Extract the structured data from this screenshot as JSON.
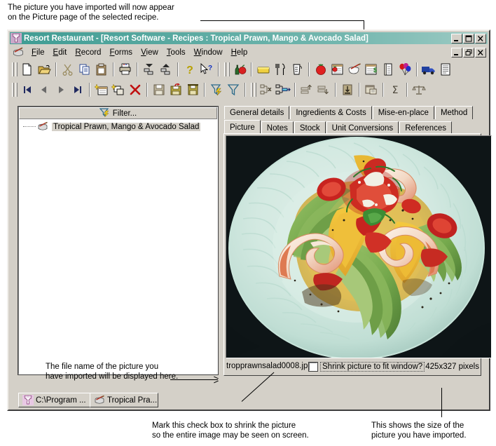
{
  "annotations": {
    "top": "The picture you have imported will now appear\non the Picture page of the selected recipe.",
    "filename_note": "The file name of the picture you\nhave imported will be displayed here.",
    "checkbox_note": "Mark this check box to shrink the picture\nso the entire image may be seen on screen.",
    "size_note": "This shows the size of the\npicture you have imported."
  },
  "window": {
    "title": "Resort Restaurant - [Resort Software - Recipes : Tropical Prawn, Mango & Avocado Salad]",
    "icon": "restaurant-app-icon",
    "titlebar_color": "#3f9c93",
    "face_color": "#d4d0c8",
    "controls": [
      {
        "name": "minimize",
        "glyph": "_"
      },
      {
        "name": "maximize",
        "glyph": "□"
      },
      {
        "name": "close",
        "glyph": "×"
      }
    ],
    "mdi_controls": [
      {
        "name": "mdi-minimize",
        "glyph": "_"
      },
      {
        "name": "mdi-restore",
        "glyph": "❐"
      },
      {
        "name": "mdi-close",
        "glyph": "×"
      }
    ]
  },
  "menu": {
    "mdi_icon": "recipe-pot-icon",
    "items": [
      {
        "label": "File",
        "accel": "F"
      },
      {
        "label": "Edit",
        "accel": "E"
      },
      {
        "label": "Record",
        "accel": "R"
      },
      {
        "label": "Forms",
        "accel": "F"
      },
      {
        "label": "View",
        "accel": "V"
      },
      {
        "label": "Tools",
        "accel": "T"
      },
      {
        "label": "Window",
        "accel": "W"
      },
      {
        "label": "Help",
        "accel": "H"
      }
    ]
  },
  "toolbar1": [
    {
      "name": "new-document-icon",
      "type": "btn"
    },
    {
      "name": "open-folder-icon",
      "type": "btn"
    },
    {
      "name": "separator",
      "type": "sep"
    },
    {
      "name": "cut-scissors-icon",
      "type": "btn"
    },
    {
      "name": "copy-icon",
      "type": "btn"
    },
    {
      "name": "paste-clipboard-icon",
      "type": "btn"
    },
    {
      "name": "separator",
      "type": "sep"
    },
    {
      "name": "print-icon",
      "type": "btn"
    },
    {
      "name": "separator",
      "type": "sep"
    },
    {
      "name": "collapse-all-icon",
      "type": "btn"
    },
    {
      "name": "expand-all-icon",
      "type": "btn"
    },
    {
      "name": "separator",
      "type": "sep"
    },
    {
      "name": "help-question-icon",
      "type": "btn"
    },
    {
      "name": "context-help-icon",
      "type": "btn"
    },
    {
      "name": "separator-double",
      "type": "sep2"
    },
    {
      "name": "bottle-and-apple-icon",
      "type": "btn"
    },
    {
      "name": "separator",
      "type": "sep"
    },
    {
      "name": "yellow-tray-icon",
      "type": "btn"
    },
    {
      "name": "cutlery-icon",
      "type": "btn"
    },
    {
      "name": "measuring-jug-icon",
      "type": "btn"
    },
    {
      "name": "separator",
      "type": "sep"
    },
    {
      "name": "tomato-icon",
      "type": "btn"
    },
    {
      "name": "ingredients-list-icon",
      "type": "btn"
    },
    {
      "name": "mixing-bowl-icon",
      "type": "btn"
    },
    {
      "name": "costing-sheet-icon",
      "type": "btn"
    },
    {
      "name": "menu-card-icon",
      "type": "btn"
    },
    {
      "name": "balloons-icon",
      "type": "btn"
    },
    {
      "name": "separator",
      "type": "sep"
    },
    {
      "name": "delivery-truck-icon",
      "type": "btn"
    },
    {
      "name": "report-icon",
      "type": "btn"
    }
  ],
  "toolbar2": [
    {
      "name": "first-record-icon",
      "type": "btn"
    },
    {
      "name": "previous-record-icon",
      "type": "btn"
    },
    {
      "name": "next-record-icon",
      "type": "btn"
    },
    {
      "name": "last-record-icon",
      "type": "btn"
    },
    {
      "name": "separator",
      "type": "sep"
    },
    {
      "name": "new-record-icon",
      "type": "btn"
    },
    {
      "name": "duplicate-record-icon",
      "type": "btn"
    },
    {
      "name": "delete-record-icon",
      "type": "btn"
    },
    {
      "name": "separator",
      "type": "sep"
    },
    {
      "name": "save-icon",
      "type": "btn"
    },
    {
      "name": "save-and-return-icon",
      "type": "btn"
    },
    {
      "name": "save-and-close-icon",
      "type": "btn"
    },
    {
      "name": "separator",
      "type": "sep"
    },
    {
      "name": "quick-filter-icon",
      "type": "btn"
    },
    {
      "name": "filter-icon",
      "type": "btn"
    },
    {
      "name": "separator-double",
      "type": "sep2"
    },
    {
      "name": "remove-link-icon",
      "type": "btn"
    },
    {
      "name": "add-link-icon",
      "type": "btn"
    },
    {
      "name": "separator",
      "type": "sep"
    },
    {
      "name": "move-up-icon",
      "type": "btn"
    },
    {
      "name": "move-down-icon",
      "type": "btn"
    },
    {
      "name": "separator",
      "type": "sep"
    },
    {
      "name": "import-icon",
      "type": "btn"
    },
    {
      "name": "separator",
      "type": "sep"
    },
    {
      "name": "properties-icon",
      "type": "btn"
    },
    {
      "name": "separator",
      "type": "sep"
    },
    {
      "name": "sum-sigma-icon",
      "type": "btn"
    },
    {
      "name": "separator",
      "type": "sep"
    },
    {
      "name": "scales-icon",
      "type": "btn"
    }
  ],
  "tree": {
    "filter_label": "Filter...",
    "filter_icon": "filter-funnel-icon",
    "items": [
      {
        "label": "Tropical Prawn, Mango & Avocado Salad",
        "icon": "recipe-pot-icon",
        "selected": true
      }
    ]
  },
  "notebook": {
    "row1": [
      {
        "label": "General details",
        "active": false
      },
      {
        "label": "Ingredients & Costs",
        "active": false
      },
      {
        "label": "Mise-en-place",
        "active": false
      },
      {
        "label": "Method",
        "active": false
      }
    ],
    "row2": [
      {
        "label": "Picture",
        "active": true
      },
      {
        "label": "Notes",
        "active": false
      },
      {
        "label": "Stock",
        "active": false
      },
      {
        "label": "Unit Conversions",
        "active": false
      },
      {
        "label": "References",
        "active": false
      }
    ]
  },
  "picture_page": {
    "image_alt": "tropical-prawn-mango-avocado-salad-photo",
    "filename": "tropprawnsalad0008.jp",
    "shrink_label": "Shrink picture to fit window?",
    "shrink_checked": false,
    "dimensions": "425x327 pixels"
  },
  "taskbar": [
    {
      "label": "C:\\Program ...",
      "icon": "explorer-folder-icon",
      "active": true
    },
    {
      "label": "Tropical Pra...",
      "icon": "recipe-pot-icon",
      "active": false
    }
  ]
}
